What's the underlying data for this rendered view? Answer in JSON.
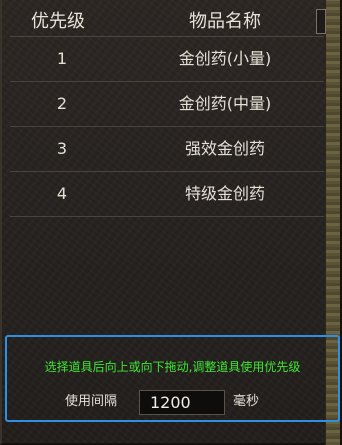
{
  "header": {
    "priority_label": "优先级",
    "item_name_label": "物品名称"
  },
  "rows": [
    {
      "priority": "1",
      "item": "金创药(小量)"
    },
    {
      "priority": "2",
      "item": "金创药(中量)"
    },
    {
      "priority": "3",
      "item": "强效金创药"
    },
    {
      "priority": "4",
      "item": "特级金创药"
    }
  ],
  "footer": {
    "hint": "选择道具后向上或向下拖动,调整道具使用优先级",
    "interval_label": "使用间隔",
    "interval_value": "1200",
    "interval_unit": "毫秒"
  },
  "colors": {
    "hint_green": "#3ee634",
    "panel_border_blue": "#2f8fe0",
    "text_light": "#e6e0d6"
  }
}
